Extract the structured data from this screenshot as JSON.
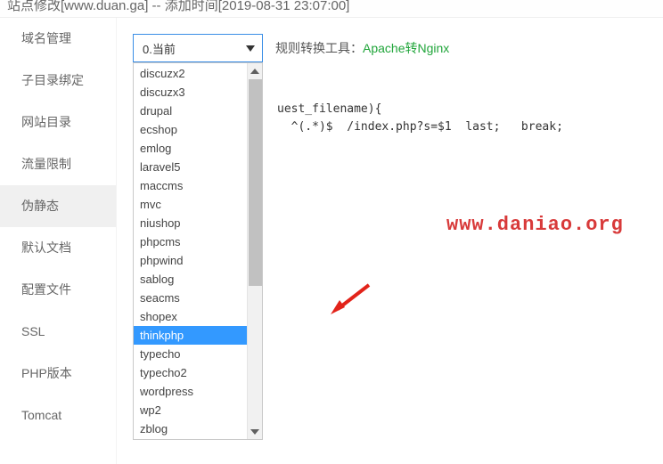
{
  "header": {
    "title": "站点修改[www.duan.ga] -- 添加时间[2019-08-31 23:07:00]"
  },
  "sidebar": {
    "items": [
      {
        "label": "域名管理",
        "active": false
      },
      {
        "label": "子目录绑定",
        "active": false
      },
      {
        "label": "网站目录",
        "active": false
      },
      {
        "label": "流量限制",
        "active": false
      },
      {
        "label": "伪静态",
        "active": true
      },
      {
        "label": "默认文档",
        "active": false
      },
      {
        "label": "配置文件",
        "active": false
      },
      {
        "label": "SSL",
        "active": false
      },
      {
        "label": "PHP版本",
        "active": false
      },
      {
        "label": "Tomcat",
        "active": false
      }
    ]
  },
  "select": {
    "current": "0.当前",
    "options": [
      "discuzx2",
      "discuzx3",
      "drupal",
      "ecshop",
      "emlog",
      "laravel5",
      "maccms",
      "mvc",
      "niushop",
      "phpcms",
      "phpwind",
      "sablog",
      "seacms",
      "shopex",
      "thinkphp",
      "typecho",
      "typecho2",
      "wordpress",
      "wp2",
      "zblog"
    ],
    "selectedIndex": 14
  },
  "toolbar": {
    "label": "规则转换工具：",
    "link": "Apache转Nginx"
  },
  "code": {
    "line1": "uest_filename){",
    "line2": "^(.*)$  /index.php?s=$1  last;   break;"
  },
  "watermark": {
    "text": "www.daniao.org"
  }
}
